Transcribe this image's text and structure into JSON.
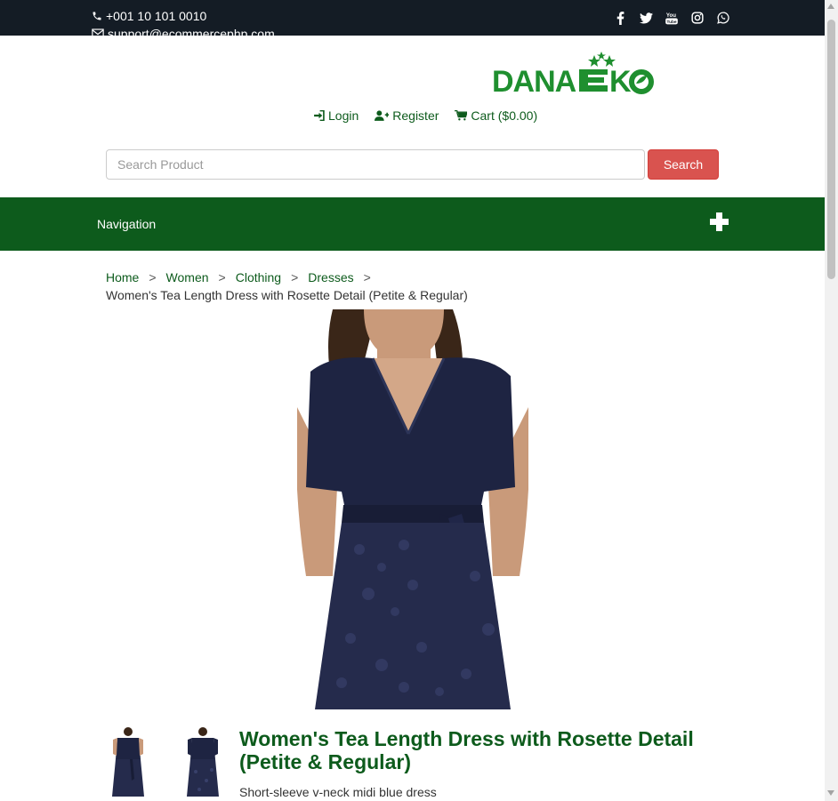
{
  "topbar": {
    "phone": "+001 10 101 0010",
    "email": "support@ecommercephp.com",
    "social_icons": [
      "facebook-icon",
      "twitter-icon",
      "youtube-icon",
      "instagram-icon",
      "whatsapp-icon"
    ]
  },
  "brand": {
    "logo_text": "DANAEKO",
    "color": "#1f8f2f"
  },
  "account": {
    "login": "Login",
    "register": "Register",
    "cart": "Cart ($0.00)"
  },
  "search": {
    "placeholder": "Search Product",
    "value": "",
    "button": "Search"
  },
  "nav": {
    "label": "Navigation"
  },
  "breadcrumb": {
    "items": [
      "Home",
      "Women",
      "Clothing",
      "Dresses"
    ],
    "separator": ">",
    "current": "Women's Tea Length Dress with Rosette Detail (Petite & Regular)"
  },
  "product": {
    "title": "Women's Tea Length Dress with Rosette Detail (Petite & Regular)",
    "subtitle": "Short-sleeve v-neck midi blue dress"
  },
  "colors": {
    "accent": "#0d5b1c",
    "topbar": "#141c25",
    "search_button": "#d9534f"
  }
}
